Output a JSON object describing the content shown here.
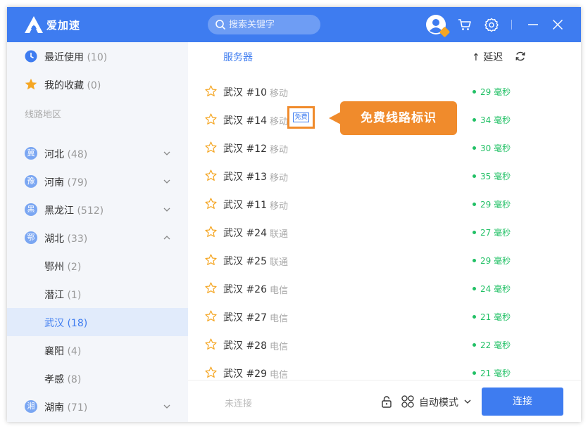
{
  "app": {
    "name": "爱加速"
  },
  "search": {
    "placeholder": "搜索关键字"
  },
  "sidebar": {
    "recent": {
      "label": "最近使用",
      "count": "(10)"
    },
    "favorites": {
      "label": "我的收藏",
      "count": "(0)"
    },
    "section_label": "线路地区",
    "provinces": [
      {
        "badge": "冀",
        "label": "河北",
        "count": "(48)"
      },
      {
        "badge": "豫",
        "label": "河南",
        "count": "(79)"
      },
      {
        "badge": "黑",
        "label": "黑龙江",
        "count": "(512)"
      },
      {
        "badge": "鄂",
        "label": "湖北",
        "count": "(33)"
      }
    ],
    "cities": [
      {
        "label": "鄂州",
        "count": "(2)"
      },
      {
        "label": "潜江",
        "count": "(1)"
      },
      {
        "label": "武汉",
        "count": "(18)"
      },
      {
        "label": "襄阳",
        "count": "(4)"
      },
      {
        "label": "孝感",
        "count": "(8)"
      }
    ],
    "hunan": {
      "badge": "湘",
      "label": "湖南",
      "count": "(71)"
    }
  },
  "main": {
    "header_server": "服务器",
    "header_latency": "延迟",
    "free_tag": "免费",
    "callout": "免费线路标识",
    "servers": [
      {
        "name": "武汉 #10",
        "isp": "移动",
        "latency": "29 毫秒"
      },
      {
        "name": "武汉 #14",
        "isp": "移动",
        "latency": "34 毫秒"
      },
      {
        "name": "武汉 #12",
        "isp": "移动",
        "latency": "30 毫秒"
      },
      {
        "name": "武汉 #13",
        "isp": "移动",
        "latency": "35 毫秒"
      },
      {
        "name": "武汉 #11",
        "isp": "移动",
        "latency": "29 毫秒"
      },
      {
        "name": "武汉 #24",
        "isp": "联通",
        "latency": "27 毫秒"
      },
      {
        "name": "武汉 #25",
        "isp": "联通",
        "latency": "29 毫秒"
      },
      {
        "name": "武汉 #26",
        "isp": "电信",
        "latency": "24 毫秒"
      },
      {
        "name": "武汉 #27",
        "isp": "电信",
        "latency": "21 毫秒"
      },
      {
        "name": "武汉 #28",
        "isp": "电信",
        "latency": "22 毫秒"
      },
      {
        "name": "武汉 #29",
        "isp": "电信",
        "latency": "21 毫秒"
      }
    ]
  },
  "bottom": {
    "status": "未连接",
    "mode": "自动模式",
    "connect": "连接"
  },
  "colors": {
    "primary": "#3e7cf0",
    "accent": "#f08b2c",
    "latency": "#21c065"
  }
}
